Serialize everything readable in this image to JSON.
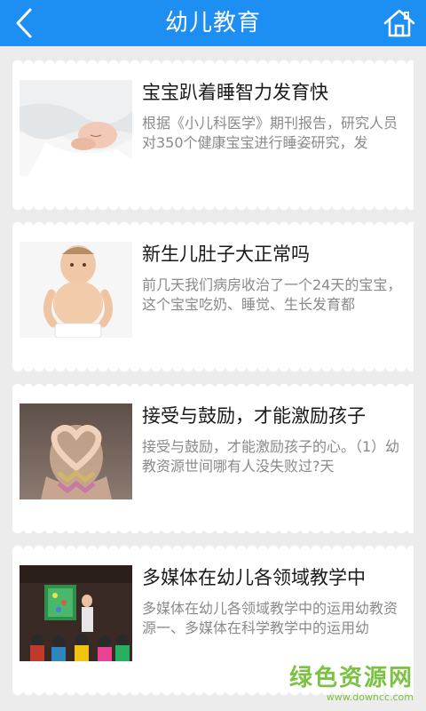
{
  "header": {
    "title": "幼儿教育",
    "back_icon": "back-arrow-icon",
    "home_icon": "home-icon",
    "background_color": "#1d8ef2"
  },
  "articles": [
    {
      "title": "宝宝趴着睡智力发育快",
      "summary": "根据《小儿科医学》期刊报告，研究人员对350个健康宝宝进行睡姿研究，发",
      "thumbnail": "sleeping-baby-image"
    },
    {
      "title": "新生儿肚子大正常吗",
      "summary": "前几天我们病房收治了一个24天的宝宝，这个宝宝吃奶、睡觉、生长发育都",
      "thumbnail": "baby-belly-image"
    },
    {
      "title": "接受与鼓励，才能激励孩子",
      "summary": "接受与鼓励，才能激励孩子的心。（1）幼教资源世间哪有人没失败过?天",
      "thumbnail": "heart-hands-image"
    },
    {
      "title": "多媒体在幼儿各领域教学中",
      "summary": "多媒体在幼儿各领域教学中的运用幼教资源一、多媒体在科学教学中的运用幼",
      "thumbnail": "classroom-image"
    }
  ],
  "watermark": {
    "main": "绿色资源网",
    "sub": "www.downcc.com",
    "color": "#7cc242"
  }
}
